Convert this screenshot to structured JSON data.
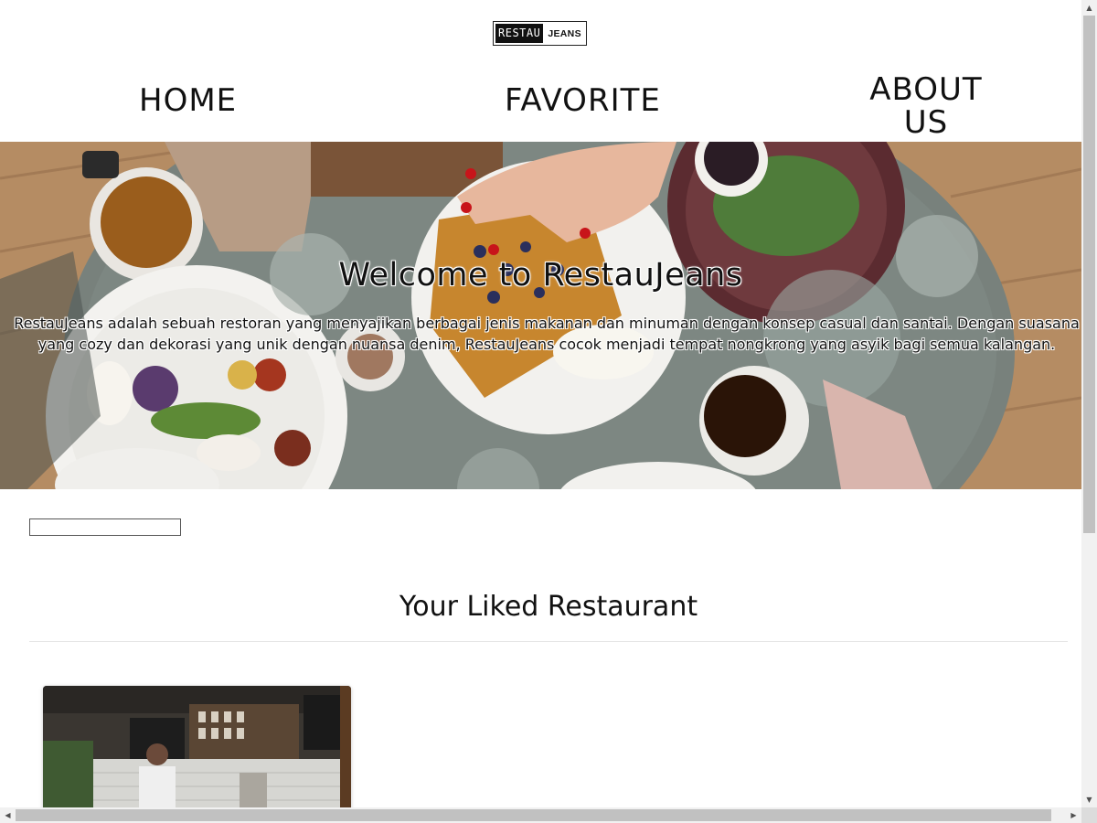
{
  "header": {
    "logo": {
      "left": "RESTAU",
      "right": "JEANS"
    },
    "nav": [
      {
        "label": "HOME"
      },
      {
        "label": "FAVORITE"
      },
      {
        "label": "ABOUT",
        "label2": "US"
      }
    ]
  },
  "hero": {
    "title": "Welcome to RestauJeans",
    "description": "RestauJeans adalah sebuah restoran yang menyajikan berbagai jenis makanan dan minuman dengan konsep casual dan santai. Dengan suasana yang cozy dan dekorasi yang unik dengan nuansa denim, RestauJeans cocok menjadi tempat nongkrong yang asyik bagi semua kalangan."
  },
  "search": {
    "value": "",
    "placeholder": ""
  },
  "liked": {
    "title": "Your Liked Restaurant"
  },
  "scrollbars": {
    "up_glyph": "▲",
    "down_glyph": "▼",
    "left_glyph": "◀",
    "right_glyph": "▶"
  }
}
